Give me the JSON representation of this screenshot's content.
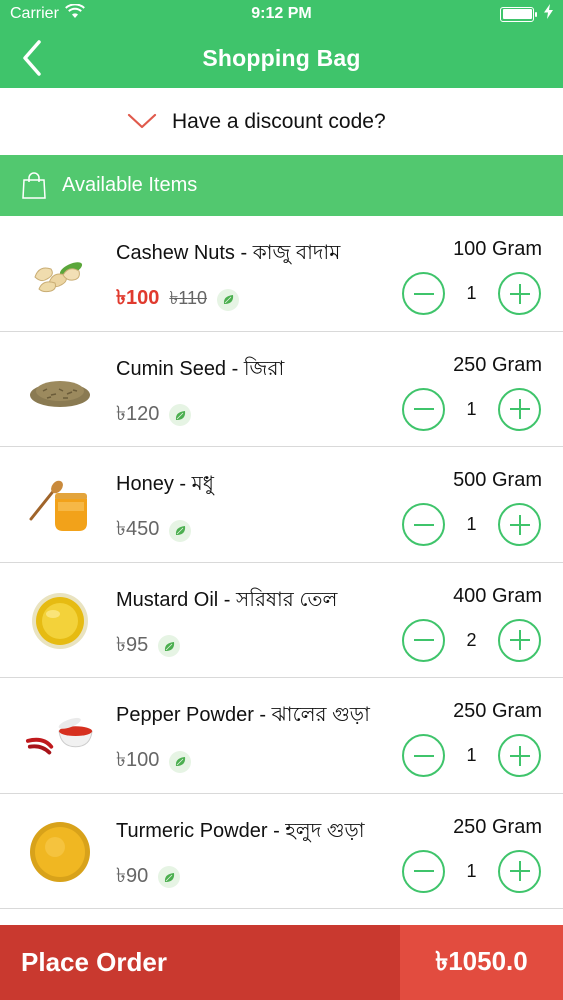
{
  "status_bar": {
    "carrier": "Carrier",
    "time": "9:12 PM"
  },
  "nav": {
    "title": "Shopping Bag"
  },
  "discount": {
    "label": "Have a discount code?"
  },
  "section": {
    "title": "Available Items"
  },
  "items": [
    {
      "name": "Cashew Nuts - কাজু বাদাম",
      "weight": "100 Gram",
      "price": "৳100",
      "old_price": "৳110",
      "qty": "1",
      "thumb": "cashew-nuts"
    },
    {
      "name": "Cumin Seed - জিরা",
      "weight": "250 Gram",
      "price": "৳120",
      "qty": "1",
      "thumb": "cumin-seed"
    },
    {
      "name": "Honey - মধু",
      "weight": "500 Gram",
      "price": "৳450",
      "qty": "1",
      "thumb": "honey"
    },
    {
      "name": "Mustard Oil - সরিষার তেল",
      "weight": "400 Gram",
      "price": "৳95",
      "qty": "2",
      "thumb": "mustard-oil"
    },
    {
      "name": "Pepper Powder - ঝালের গুড়া",
      "weight": "250 Gram",
      "price": "৳100",
      "qty": "1",
      "thumb": "pepper-powder"
    },
    {
      "name": "Turmeric Powder - হলুদ গুড়া",
      "weight": "250 Gram",
      "price": "৳90",
      "qty": "1",
      "thumb": "turmeric-powder"
    }
  ],
  "footer": {
    "place_order": "Place Order",
    "total": "৳1050.0"
  },
  "colors": {
    "primary_green": "#3fc46b",
    "section_green": "#52c86f",
    "sale_red": "#e03a2e",
    "order_red": "#c9392f",
    "total_red": "#e24c3f"
  }
}
